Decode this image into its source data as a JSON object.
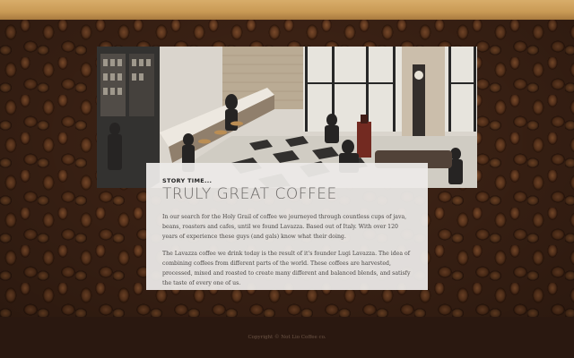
{
  "story": {
    "eyebrow": "STORY TIME...",
    "headline": "TRULY GREAT COFFEE",
    "paragraphs": [
      "In our search for the Holy Grail of coffee we journeyed through countless cups of java, beans, roasters and cafes, until we found Lavazza. Based out of Italy. With over 120 years of experience these guys (and gals) know what their doing.",
      "The Lavazza coffee we drink today is the result of it's founder Lugi Lavazza. The idea of combining coffees from different parts of the world. These coffees are harvested, processed, mixed and roasted to create many different and balanced blends, and satisfy the taste of every one of us."
    ]
  },
  "footer": {
    "copyright": "Copyright © Not Lio Coffee co."
  },
  "colors": {
    "top_strip": "#c99a55",
    "background": "#2a1810",
    "card": "#eceae8",
    "headline": "#6b6866"
  }
}
